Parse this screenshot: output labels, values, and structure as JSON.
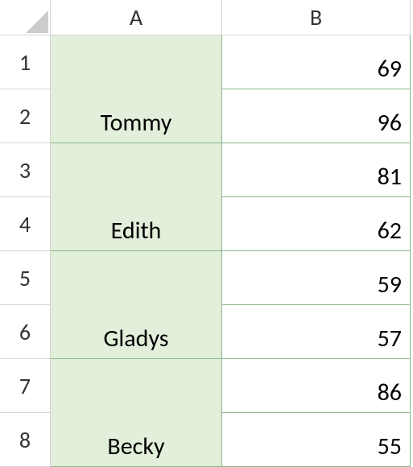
{
  "headers": {
    "colA": "A",
    "colB": "B",
    "row1": "1",
    "row2": "2",
    "row3": "3",
    "row4": "4",
    "row5": "5",
    "row6": "6",
    "row7": "7",
    "row8": "8"
  },
  "cells": {
    "a12": "Tommy",
    "a34": "Edith",
    "a56": "Gladys",
    "a78": "Becky",
    "b1": "69",
    "b2": "96",
    "b3": "81",
    "b4": "62",
    "b5": "59",
    "b6": "57",
    "b7": "86",
    "b8": "55"
  },
  "chart_data": {
    "type": "table",
    "columns": [
      "A",
      "B"
    ],
    "rows": [
      {
        "A": "Tommy",
        "B": 69
      },
      {
        "A": "Tommy",
        "B": 96
      },
      {
        "A": "Edith",
        "B": 81
      },
      {
        "A": "Edith",
        "B": 62
      },
      {
        "A": "Gladys",
        "B": 59
      },
      {
        "A": "Gladys",
        "B": 57
      },
      {
        "A": "Becky",
        "B": 86
      },
      {
        "A": "Becky",
        "B": 55
      }
    ]
  }
}
